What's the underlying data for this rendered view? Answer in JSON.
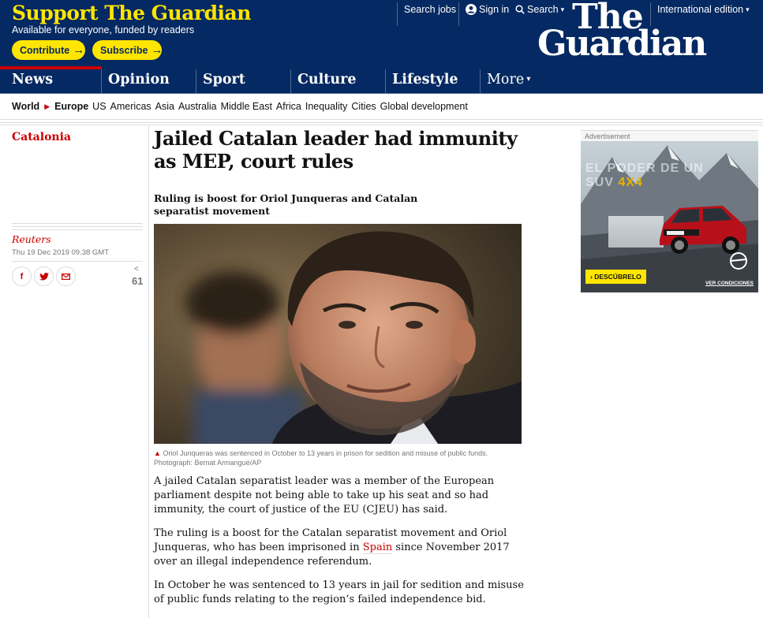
{
  "support": {
    "title": "Support The Guardian",
    "subtitle": "Available for everyone, funded by readers",
    "contribute_label": "Contribute",
    "subscribe_label": "Subscribe"
  },
  "top_links": {
    "search_jobs": "Search jobs",
    "sign_in": "Sign in",
    "search": "Search",
    "edition": "International edition"
  },
  "logo": {
    "line1": "The",
    "line2": "Guardian"
  },
  "pillars": [
    "News",
    "Opinion",
    "Sport",
    "Culture",
    "Lifestyle",
    "More"
  ],
  "subnav": [
    "World",
    "Europe",
    "US",
    "Americas",
    "Asia",
    "Australia",
    "Middle East",
    "Africa",
    "Inequality",
    "Cities",
    "Global development"
  ],
  "article": {
    "section": "Catalonia",
    "byline": "Reuters",
    "date": "Thu 19 Dec 2019 09.38 GMT",
    "share_count": "61",
    "headline": "Jailed Catalan leader had immunity as MEP, court rules",
    "standfirst": "Ruling is boost for Oriol Junqueras and Catalan separatist movement",
    "caption": "Oriol Junqueras was sentenced in October to 13 years in prison for sedition and misuse of public funds. Photograph: Bernat Armangué/AP",
    "p1": "A jailed Catalan separatist leader was a member of the European parliament despite not being able to take up his seat and so had immunity, the court of justice of the EU (CJEU) has said.",
    "p2_before": "The ruling is a boost for the Catalan separatist movement and Oriol Junqueras, who has been imprisoned in ",
    "p2_link": "Spain",
    "p2_after": " since November 2017 over an illegal independence referendum.",
    "p3": "In October he was sentenced to 13 years in jail for sedition and misuse of public funds relating to the region’s failed independence bid."
  },
  "ad": {
    "label": "Advertisement",
    "headline_1": "EL PODER DE UN",
    "headline_2a": "SUV ",
    "headline_2b": "4X4",
    "cta": "› DESCÚBRELO",
    "terms": "VER CONDICIONES"
  },
  "colors": {
    "brand_blue": "#052962",
    "accent_yellow": "#ffe500",
    "news_red": "#c70000"
  }
}
